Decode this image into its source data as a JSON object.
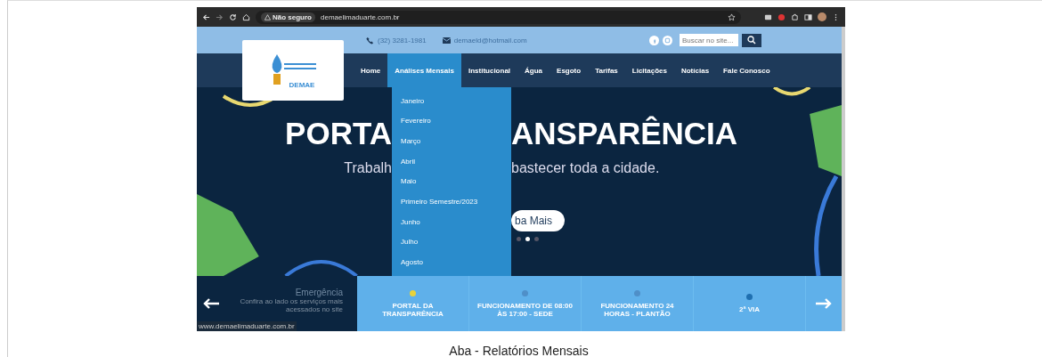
{
  "browser": {
    "security": "Não seguro",
    "url": "demaelimaduarte.com.br"
  },
  "top_bar": {
    "phone": "(32) 3281-1981",
    "email": "demaeld@hotmail.com",
    "search_placeholder": "Buscar no site..."
  },
  "logo": {
    "text": "DEMAE"
  },
  "nav": [
    {
      "label": "Home",
      "selected": false
    },
    {
      "label": "Análises Mensais",
      "selected": true
    },
    {
      "label": "Institucional",
      "selected": false
    },
    {
      "label": "Água",
      "selected": false
    },
    {
      "label": "Esgoto",
      "selected": false
    },
    {
      "label": "Tarifas",
      "selected": false
    },
    {
      "label": "Licitações",
      "selected": false
    },
    {
      "label": "Notícias",
      "selected": false
    },
    {
      "label": "Fale Conosco",
      "selected": false
    }
  ],
  "dropdown": [
    "Janeiro",
    "Fevereiro",
    "Março",
    "Abril",
    "Maio",
    "Primeiro Semestre/2023",
    "Junho",
    "Julho",
    "Agosto"
  ],
  "hero": {
    "title_left": "PORTA",
    "title_right": "ANSPARÊNCIA",
    "subtitle_left": "Trabalh",
    "subtitle_right": "bastecer toda a cidade.",
    "button": "ba Mais",
    "dots": [
      {
        "selected": false
      },
      {
        "selected": true
      },
      {
        "selected": false
      }
    ]
  },
  "emergency": {
    "title": "Emergência",
    "text": "Confira ao lado os serviços mais acessados no site"
  },
  "services": [
    {
      "label": "PORTAL DA TRANSPARÊNCIA",
      "color": "#e8d23a"
    },
    {
      "label": "FUNCIONAMENTO DE 08:00 ÀS 17:00 - SEDE",
      "color": "#4f8fc8"
    },
    {
      "label": "FUNCIONAMENTO 24 HORAS - PLANTÃO",
      "color": "#4f8fc8"
    },
    {
      "label": "2ª VIA",
      "color": "#1f6fb0"
    }
  ],
  "status_url": "www.demaelimaduarte.com.br",
  "caption": "Aba - Relatórios Mensais"
}
